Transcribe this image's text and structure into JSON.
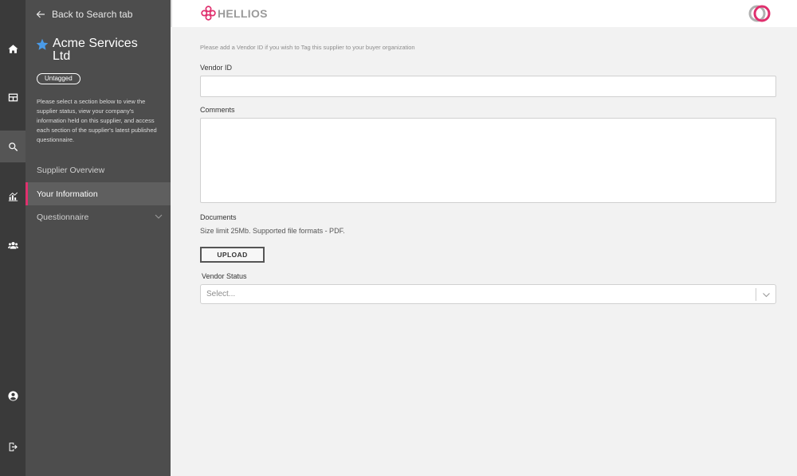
{
  "rail": {
    "items": [
      {
        "name": "home",
        "icon": "home-icon"
      },
      {
        "name": "dashboard",
        "icon": "grid-icon"
      },
      {
        "name": "search",
        "icon": "search-icon"
      },
      {
        "name": "analytics",
        "icon": "bar-chart-icon"
      },
      {
        "name": "users",
        "icon": "users-icon"
      },
      {
        "name": "profile",
        "icon": "user-circle-icon"
      },
      {
        "name": "logout",
        "icon": "logout-icon"
      }
    ],
    "active": "search"
  },
  "panel": {
    "back_label": "Back to Search tab",
    "supplier_name": "Acme Services Ltd",
    "tag_badge": "Untagged",
    "intro": "Please select a section below to view the supplier status, view your company's information held on this supplier, and access each section of the supplier's latest published questionnaire.",
    "nav": [
      {
        "label": "Supplier Overview"
      },
      {
        "label": "Your Information"
      },
      {
        "label": "Questionnaire"
      }
    ],
    "active_nav": "Your Information"
  },
  "header": {
    "brand": "HELLIOS"
  },
  "form": {
    "hint": "Please add a Vendor ID if you wish to Tag this supplier to your buyer organization",
    "vendor_id_label": "Vendor ID",
    "vendor_id_value": "",
    "comments_label": "Comments",
    "comments_value": "",
    "documents_label": "Documents",
    "documents_note": "Size limit 25Mb. Supported file formats - PDF.",
    "upload_label": "UPLOAD",
    "vendor_status_label": "Vendor Status",
    "vendor_status_placeholder": "Select..."
  },
  "colors": {
    "accent": "#e0306e",
    "rail_bg": "#3a3a3a",
    "panel_bg": "#4d4d4d",
    "star": "#4a9be8"
  }
}
